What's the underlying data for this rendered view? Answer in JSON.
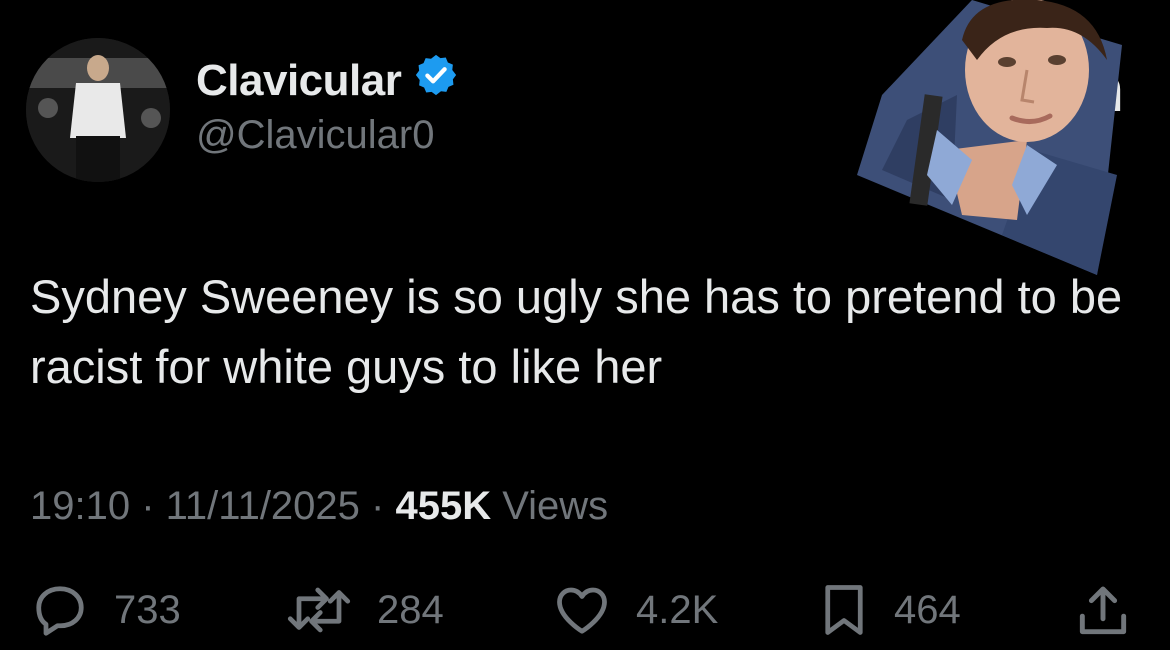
{
  "author": {
    "display_name": "Clavicular",
    "handle": "@Clavicular0",
    "verified_icon": "verified-badge-icon",
    "avatar": "profile-avatar-runway-photo"
  },
  "brand": {
    "logo_icon": "x-logo-icon",
    "tail_text": "n"
  },
  "sticker": {
    "description_icon": "cutout-photo-sticker"
  },
  "tweet": {
    "text": "Sydney Sweeney is so ugly she has to pretend to be racist for white guys to like her"
  },
  "meta": {
    "time": "19:10",
    "sep1": " · ",
    "date": "11/11/2025",
    "sep2": " · ",
    "views_count": "455K",
    "views_label": " Views"
  },
  "actions": {
    "replies": "733",
    "reposts": "284",
    "likes": "4.2K",
    "bookmarks": "464"
  },
  "colors": {
    "background": "#000000",
    "text": "#e7e9ea",
    "muted": "#71767b",
    "verified": "#1d9bf0"
  }
}
